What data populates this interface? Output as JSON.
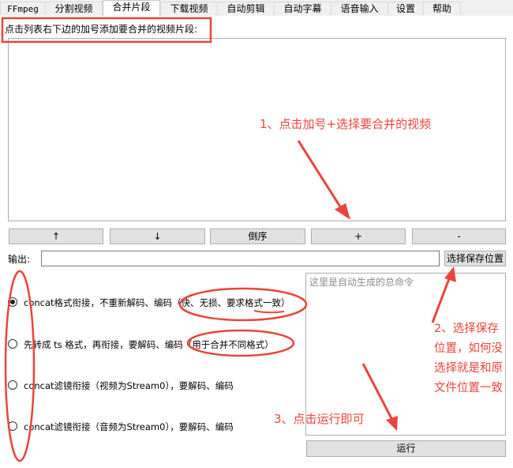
{
  "tabs": [
    "FFmpeg",
    "分割视频",
    "合并片段",
    "下载视频",
    "自动剪辑",
    "自动字幕",
    "语音输入",
    "设置",
    "帮助"
  ],
  "active_tab": "合并片段",
  "hint": "点击列表右下边的加号添加要合并的视频片段:",
  "list_buttons": {
    "up": "↑",
    "down": "↓",
    "reverse": "倒序",
    "add": "+",
    "remove": "-"
  },
  "output": {
    "label": "输出:",
    "value": "",
    "choose_button": "选择保存位置"
  },
  "command_placeholder": "这里是自动生成的总命令",
  "options": [
    {
      "label": "concat格式衔接，不重新解码、编码（快、无损、要求格式一致）",
      "selected": true
    },
    {
      "label": "先转成 ts 格式，再衔接，要解码、编码（用于合并不同格式）",
      "selected": false
    },
    {
      "label": "concat滤镜衔接（视频为Stream0），要解码、编码",
      "selected": false
    },
    {
      "label": "concat滤镜衔接（音频为Stream0），要解码、编码",
      "selected": false
    }
  ],
  "run_button": "运行",
  "annotations": {
    "step1": "1、点击加号+选择要合并的视频",
    "step2": "2、选择保存位置，如何没选择就是和原文件位置一致",
    "step3": "3、点击运行即可"
  },
  "colors": {
    "annotation_red": "#e8453c",
    "button_bg": "#e1e1e1"
  }
}
